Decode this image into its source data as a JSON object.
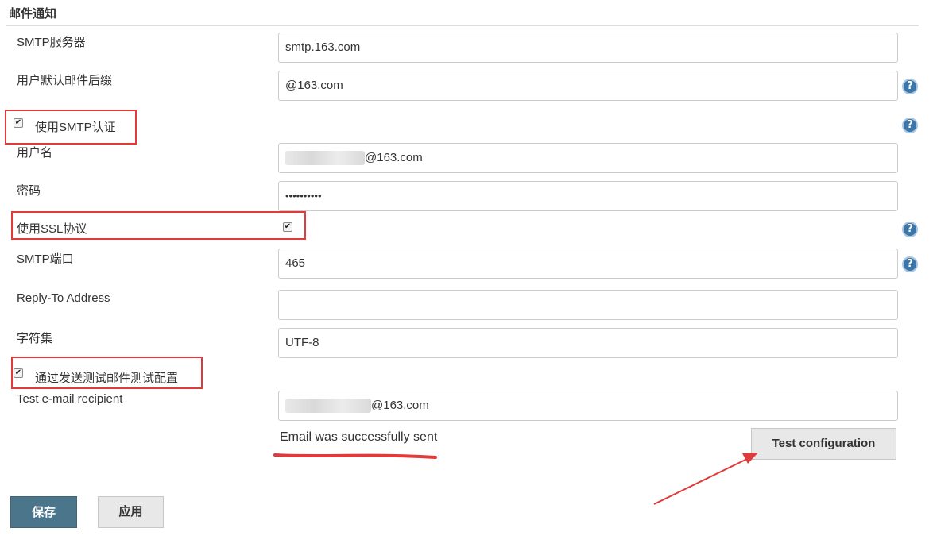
{
  "section": {
    "title": "邮件通知"
  },
  "fields": {
    "smtp_server": {
      "label": "SMTP服务器",
      "value": "smtp.163.com"
    },
    "default_suffix": {
      "label": "用户默认邮件后缀",
      "value": "@163.com"
    },
    "use_smtp_auth": {
      "label": "使用SMTP认证",
      "checked": true
    },
    "username": {
      "label": "用户名",
      "value_visible": "@163.com"
    },
    "password": {
      "label": "密码",
      "value": "••••••••••"
    },
    "use_ssl": {
      "label": "使用SSL协议",
      "checked": true
    },
    "smtp_port": {
      "label": "SMTP端口",
      "value": "465"
    },
    "reply_to": {
      "label": "Reply-To Address",
      "value": ""
    },
    "charset": {
      "label": "字符集",
      "value": "UTF-8"
    },
    "test_by_sending": {
      "label": "通过发送测试邮件测试配置",
      "checked": true
    },
    "test_recipient": {
      "label": "Test e-mail recipient",
      "value_visible": "@163.com"
    }
  },
  "test": {
    "status": "Email was successfully sent",
    "button_label": "Test configuration"
  },
  "footer": {
    "save_label": "保存",
    "apply_label": "应用"
  },
  "icons": {
    "help": "help-icon",
    "checkbox_mark": "✔"
  },
  "colors": {
    "annotation_red": "#e03a3a",
    "save_button": "#4b758b",
    "help_icon": "#3c76a8"
  }
}
